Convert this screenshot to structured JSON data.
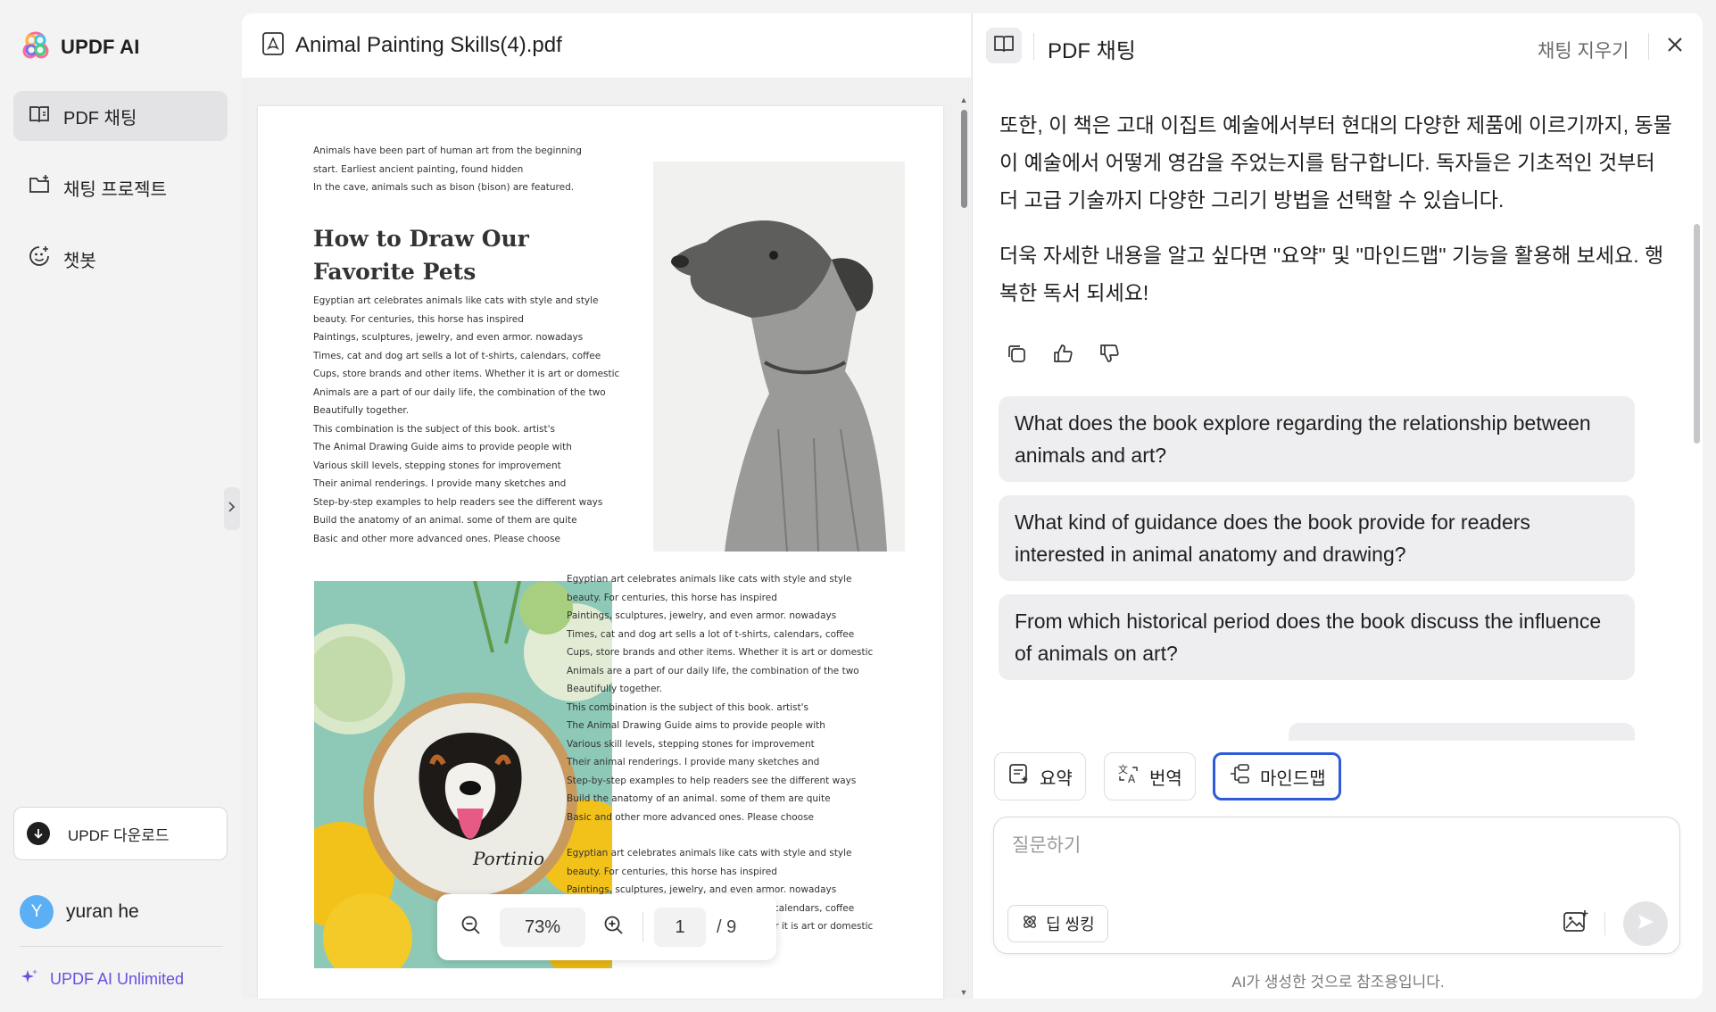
{
  "app": {
    "name": "UPDF AI"
  },
  "sidebar": {
    "items": [
      {
        "label": "PDF 채팅",
        "icon": "book-open-icon",
        "active": true
      },
      {
        "label": "채팅 프로젝트",
        "icon": "folder-plus-icon",
        "active": false
      },
      {
        "label": "챗봇",
        "icon": "bot-face-icon",
        "active": false
      }
    ],
    "download_label": "UPDF 다운로드",
    "user": {
      "initial": "Y",
      "name": "yuran he"
    },
    "unlimited_label": "UPDF AI Unlimited"
  },
  "document": {
    "filename": "Animal Painting Skills(4).pdf",
    "page": {
      "intro_lines": [
        "Animals have been part of human art from the beginning",
        "start. Earliest ancient painting, found hidden",
        "In the cave, animals such as bison (bison) are featured."
      ],
      "heading_lines": [
        "How to Draw Our",
        "Favorite Pets"
      ],
      "body_lines": [
        "Egyptian art celebrates animals like cats with style and style",
        "beauty. For centuries, this horse has inspired",
        "Paintings, sculptures, jewelry, and even armor. nowadays",
        "Times, cat and dog art sells a lot of t-shirts, calendars, coffee",
        "Cups, store brands and other items. Whether it is art or domestic",
        "Animals are a part of our daily life, the combination of the two",
        "Beautifully together.",
        "This combination is the subject of this book. artist's",
        "The Animal Drawing Guide aims to provide people with",
        "Various skill levels, stepping stones for improvement",
        "Their animal renderings. I provide many sketches and",
        "Step-by-step examples to help readers see the different ways",
        "Build the anatomy of an animal. some of them are quite",
        "Basic and other more advanced ones. Please choose"
      ],
      "tail_lines": [
        "Egyptian art celebrates animals like cats with style and style",
        "beauty. For centuries, this horse has inspired",
        "Paintings, sculptures, jewelry, and even armor. nowadays",
        "Times, cat and dog art sells a lot of t-shirts, calendars, coffee",
        "Cups, store brands and other items. Whether it is art or domestic"
      ],
      "embroidery_signature": "Portinio"
    },
    "zoom": "73%",
    "current_page": "1",
    "total_pages": "/ 9"
  },
  "chat": {
    "title": "PDF 채팅",
    "clear_label": "채팅 지우기",
    "answer_paragraphs": [
      "또한, 이 책은 고대 이집트 예술에서부터 현대의 다양한 제품에 이르기까지, 동물이 예술에서 어떻게 영감을 주었는지를 탐구합니다. 독자들은 기초적인 것부터 더 고급 기술까지 다양한 그리기 방법을 선택할 수 있습니다.",
      "더욱 자세한 내용을 알고 싶다면 \"요약\" 및 \"마인드맵\" 기능을 활용해 보세요. 행복한 독서 되세요!"
    ],
    "suggestions": [
      "What does the book explore regarding the relationship between animals and art?",
      "What kind of guidance does the book provide for readers interested in animal anatomy and drawing?",
      "From which historical period does the book discuss the influence of animals on art?"
    ],
    "tools": [
      {
        "label": "요약",
        "icon": "summary-icon"
      },
      {
        "label": "번역",
        "icon": "translate-icon"
      },
      {
        "label": "마인드맵",
        "icon": "mindmap-icon",
        "selected": true
      }
    ],
    "input_placeholder": "질문하기",
    "deep_thinking_label": "딥 씽킹",
    "disclaimer": "AI가 생성한 것으로 참조용입니다."
  },
  "colors": {
    "accent": "#2f5bd8",
    "brand_purple": "#6a4ee0",
    "avatar": "#5bb0f5"
  }
}
